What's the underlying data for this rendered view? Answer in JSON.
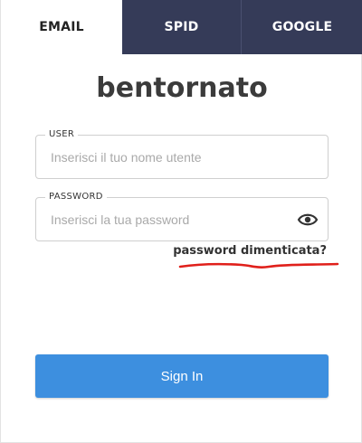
{
  "tabs": [
    {
      "label": "EMAIL",
      "active": true
    },
    {
      "label": "SPID",
      "active": false
    },
    {
      "label": "GOOGLE",
      "active": false
    }
  ],
  "title": "bentornato",
  "user_field": {
    "label": "USER",
    "placeholder": "Inserisci il tuo nome utente",
    "value": ""
  },
  "password_field": {
    "label": "PASSWORD",
    "placeholder": "Inserisci la tua password",
    "value": "",
    "toggle_icon": "eye-icon"
  },
  "forgot_password": "password dimenticata?",
  "sign_in_label": "Sign In",
  "colors": {
    "tab_inactive": "#353b58",
    "button": "#3d8fdf",
    "annotation": "#e0201b"
  }
}
